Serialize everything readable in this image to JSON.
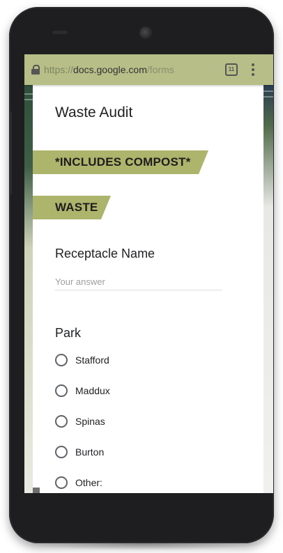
{
  "browser": {
    "url_scheme": "https://",
    "url_host": "docs.google.com",
    "url_path": "/forms",
    "tab_count": "11"
  },
  "form": {
    "title": "Waste Audit",
    "sections": [
      "*INCLUDES COMPOST*",
      "WASTE"
    ],
    "questions": [
      {
        "title": "Receptacle Name",
        "placeholder": "Your answer"
      },
      {
        "title": "Park",
        "options": [
          "Stafford",
          "Maddux",
          "Spinas",
          "Burton",
          "Other:"
        ]
      }
    ]
  },
  "colors": {
    "url_bar": "#b7be87",
    "banner": "#adb46b",
    "phone_body": "#1e1e20"
  },
  "icons": [
    "lock-icon",
    "tabs-icon",
    "menu-icon"
  ]
}
